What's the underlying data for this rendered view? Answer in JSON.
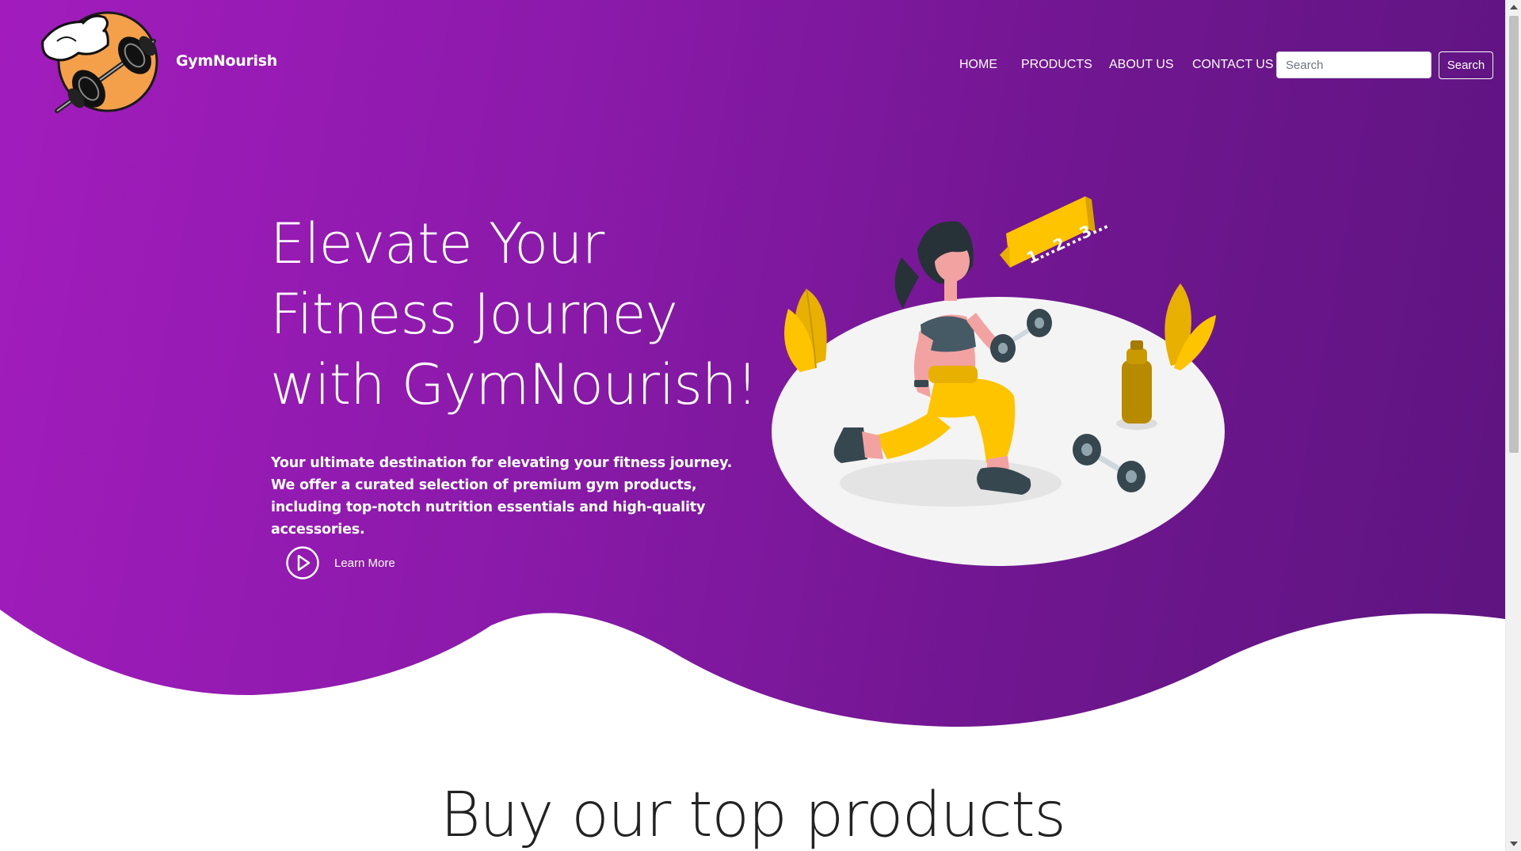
{
  "brand": {
    "name": "GymNourish",
    "logo_icon": "muscle-arm-barbell-icon"
  },
  "nav": {
    "items": [
      {
        "label": "HOME"
      },
      {
        "label": "PRODUCTS"
      },
      {
        "label": "ABOUT US"
      },
      {
        "label": "CONTACT US"
      }
    ]
  },
  "search": {
    "placeholder": "Search",
    "value": "",
    "button_label": "Search"
  },
  "hero": {
    "title_lines": [
      "Elevate Your",
      "Fitness Journey",
      "with GymNourish!"
    ],
    "description": "Your ultimate destination for elevating your fitness journey. We offer a curated selection of premium gym products, including top-notch nutrition essentials and high-quality accessories.",
    "cta_label": "Learn More",
    "cta_icon": "play-circle-icon",
    "illustration_text": "1...2...3..."
  },
  "section": {
    "title": "Buy our top products"
  },
  "colors": {
    "hero_gradient_start": "#a21cbd",
    "hero_gradient_end": "#5e1480",
    "accent_yellow": "#ffc400",
    "logo_orange": "#f4a04a"
  }
}
